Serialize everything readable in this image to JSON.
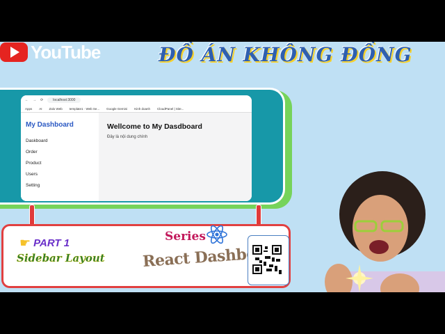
{
  "brand": {
    "name": "YouTube"
  },
  "headline": "ĐỒ ÁN KHÔNG ĐỒNG",
  "browser": {
    "url": "localhost:3000",
    "bookmarks": [
      "Apps",
      "AI",
      "Zalo Web",
      "template1 · Web Se...",
      "Google Gemini",
      "Kinh doanh",
      "CloudPanel | Site..."
    ]
  },
  "dashboard": {
    "title": "My Dashboard",
    "menu": [
      "Daskboard",
      "Order",
      "Product",
      "Users",
      "Setting"
    ],
    "heading": "Wellcome to My Dasdboard",
    "body": "Đây là nội dung chính"
  },
  "labels": {
    "part": "PART 1",
    "sidebar_layout": "Sidebar Layout",
    "series": "Series",
    "react_dashboard": "React Dashboard"
  },
  "colors": {
    "accent_teal": "#1798a8",
    "accent_green": "#76d35a",
    "border_red": "#e14040",
    "youtube_red": "#e52420"
  }
}
